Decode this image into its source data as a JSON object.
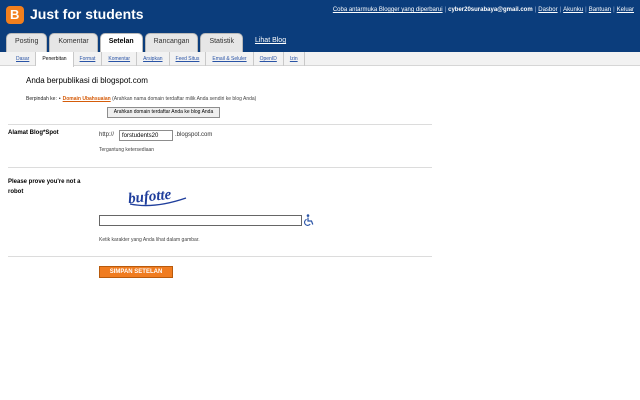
{
  "header": {
    "logo_letter": "B",
    "blog_title": "Just for students",
    "top_nav": {
      "beta_link": "Coba antarmuka Blogger yang diperbarui",
      "email": "cyber20surabaya@gmail.com",
      "dashboard": "Dasbor",
      "account": "Akunku",
      "help": "Bantuan",
      "logout": "Keluar"
    }
  },
  "tabs": [
    {
      "label": "Posting"
    },
    {
      "label": "Komentar"
    },
    {
      "label": "Setelan",
      "active": true
    },
    {
      "label": "Rancangan"
    },
    {
      "label": "Statistik"
    },
    {
      "label": "Lihat Blog"
    }
  ],
  "subnav": [
    {
      "label": "Dasar"
    },
    {
      "label": "Penerbitan",
      "active": true
    },
    {
      "label": "Format"
    },
    {
      "label": "Komentar"
    },
    {
      "label": "Arsipkan"
    },
    {
      "label": "Feed Situs"
    },
    {
      "label": "Email & Seluler"
    },
    {
      "label": "OpenID"
    },
    {
      "label": "Izin"
    }
  ],
  "publishing": {
    "title": "Anda berpublikasi di blogspot.com",
    "move_label": "Berpindah ke:",
    "bullet": "•",
    "domain_link": "Domain Ubahsuaian",
    "domain_hint": "(Arahkan nama domain terdaftar milik Anda sendiri ke blog Anda)",
    "advanced_button": "Arahkan domain terdaftar Anda ke blog Anda"
  },
  "address": {
    "label": "Alamat Blog*Spot",
    "prefix": "http://",
    "value": "forstudents20",
    "suffix": ".blogspot.com",
    "note": "Tergantung ketersediaan"
  },
  "captcha": {
    "label": "Please prove you're not a robot",
    "word": "bufotte",
    "input_value": "",
    "instruction": "Ketik karakter yang Anda lihat dalam gambar.",
    "audio_icon": "wheelchair-accessibility-icon"
  },
  "save_button": "SIMPAN SETELAN",
  "colors": {
    "header_bg": "#0b3d7c",
    "accent_orange": "#f07c20",
    "link_blue": "#2a54a6"
  }
}
